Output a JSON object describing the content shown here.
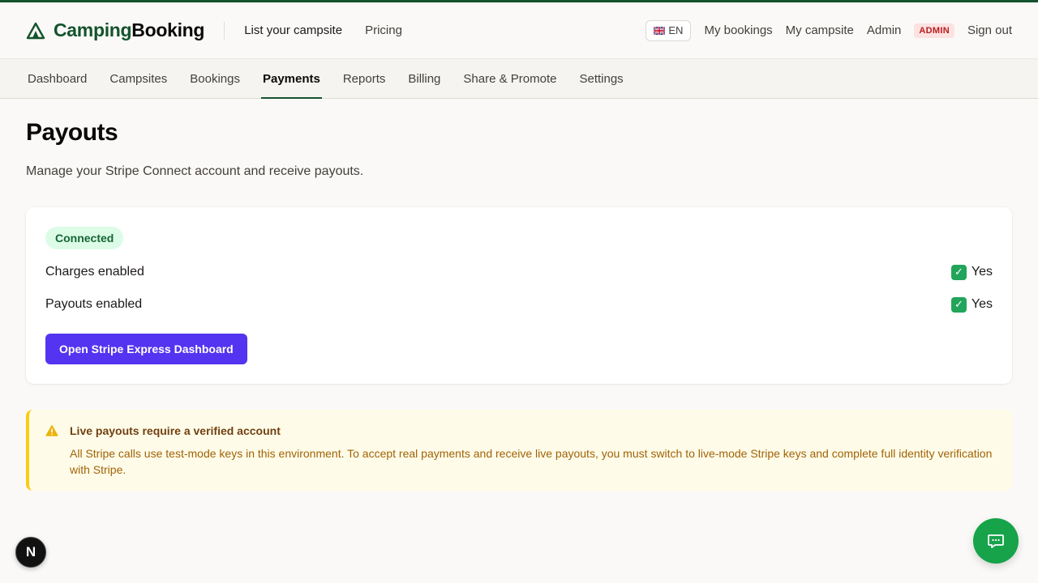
{
  "brand": {
    "part1": "Camping",
    "part2": "Booking",
    "accent_color": "#14532d"
  },
  "header": {
    "list_campsite": "List your campsite",
    "pricing": "Pricing",
    "language": "EN",
    "my_bookings": "My bookings",
    "my_campsite": "My campsite",
    "admin": "Admin",
    "admin_badge": "ADMIN",
    "sign_out": "Sign out"
  },
  "tabs": [
    {
      "label": "Dashboard",
      "active": false
    },
    {
      "label": "Campsites",
      "active": false
    },
    {
      "label": "Bookings",
      "active": false
    },
    {
      "label": "Payments",
      "active": true
    },
    {
      "label": "Reports",
      "active": false
    },
    {
      "label": "Billing",
      "active": false
    },
    {
      "label": "Share & Promote",
      "active": false
    },
    {
      "label": "Settings",
      "active": false
    }
  ],
  "page": {
    "title": "Payouts",
    "subtitle": "Manage your Stripe Connect account and receive payouts."
  },
  "card": {
    "status": "Connected",
    "rows": [
      {
        "label": "Charges enabled",
        "value": "Yes"
      },
      {
        "label": "Payouts enabled",
        "value": "Yes"
      }
    ],
    "button": "Open Stripe Express Dashboard",
    "button_color": "#5434f0"
  },
  "warning": {
    "title": "Live payouts require a verified account",
    "text": "All Stripe calls use test-mode keys in this environment. To accept real payments and receive live payouts, you must switch to live-mode Stripe keys and complete full identity verification with Stripe."
  },
  "floating": {
    "next_badge": "N",
    "chat_color": "#16a34a"
  }
}
